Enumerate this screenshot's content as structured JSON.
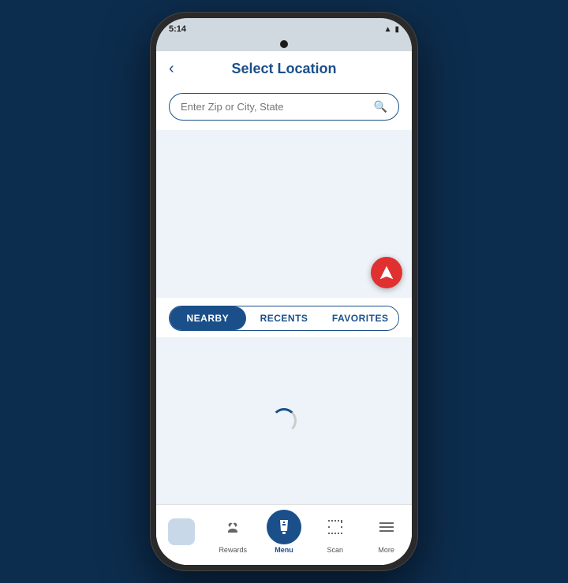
{
  "statusBar": {
    "time": "5:14",
    "icons": "● ♦ ↑ ◈ ·"
  },
  "header": {
    "backLabel": "‹",
    "title": "Select Location"
  },
  "search": {
    "placeholder": "Enter Zip or City, State"
  },
  "tabs": [
    {
      "id": "nearby",
      "label": "NEARBY",
      "active": true
    },
    {
      "id": "recents",
      "label": "RECENTS",
      "active": false
    },
    {
      "id": "favorites",
      "label": "FAVORITES",
      "active": false
    }
  ],
  "bottomNav": [
    {
      "id": "home",
      "label": "",
      "active": false,
      "type": "home"
    },
    {
      "id": "rewards",
      "label": "Rewards",
      "active": false,
      "type": "rewards"
    },
    {
      "id": "menu",
      "label": "Menu",
      "active": true,
      "type": "menu"
    },
    {
      "id": "scan",
      "label": "Scan",
      "active": false,
      "type": "scan"
    },
    {
      "id": "more",
      "label": "More",
      "active": false,
      "type": "more"
    }
  ],
  "colors": {
    "primary": "#1a4f8a",
    "accent": "#e03030",
    "bg": "#edf3f8"
  }
}
